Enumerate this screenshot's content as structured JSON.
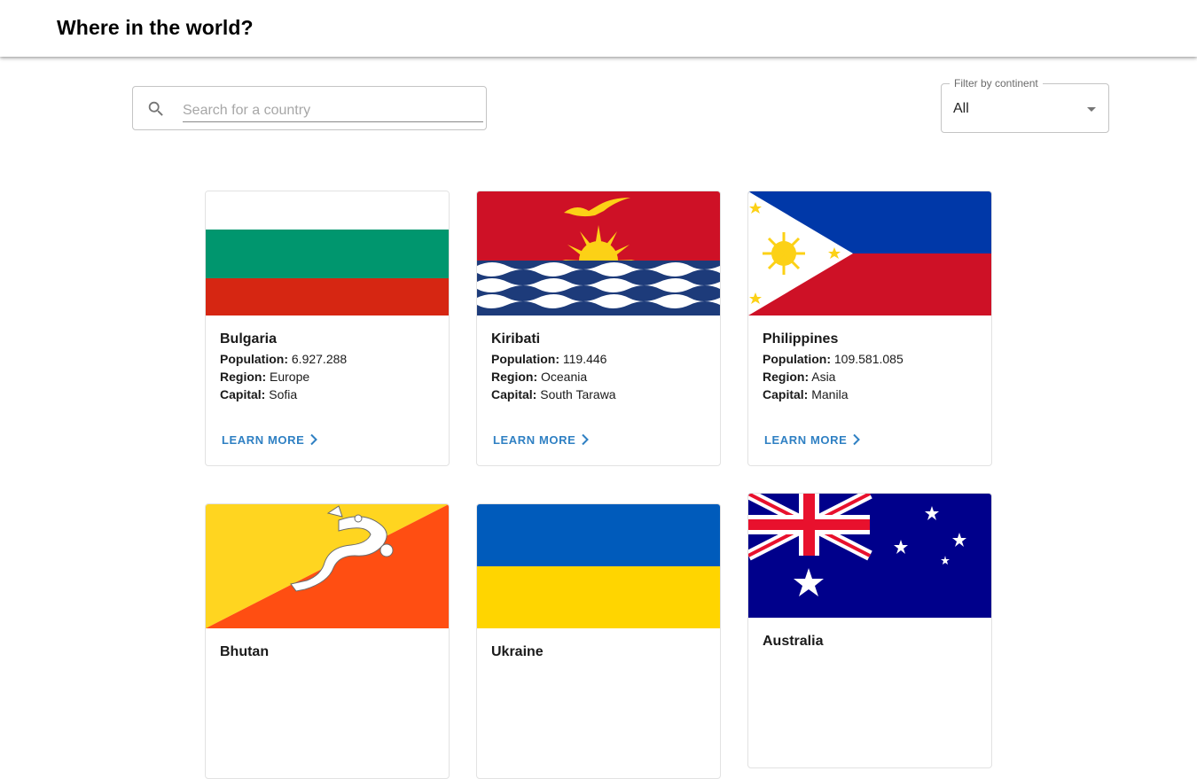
{
  "header": {
    "title": "Where in the world?"
  },
  "search": {
    "placeholder": "Search for a country",
    "value": ""
  },
  "filter": {
    "label": "Filter by continent",
    "value": "All"
  },
  "labels": {
    "population": "Population:",
    "region": "Region:",
    "capital": "Capital:",
    "learn_more": "LEARN MORE"
  },
  "countries": [
    {
      "name": "Bulgaria",
      "population": "6.927.288",
      "region": "Europe",
      "capital": "Sofia"
    },
    {
      "name": "Kiribati",
      "population": "119.446",
      "region": "Oceania",
      "capital": "South Tarawa"
    },
    {
      "name": "Philippines",
      "population": "109.581.085",
      "region": "Asia",
      "capital": "Manila"
    },
    {
      "name": "Bhutan"
    },
    {
      "name": "Ukraine"
    },
    {
      "name": "Australia"
    }
  ],
  "colors": {
    "accent": "#2f80c3",
    "border": "#c4c4c4"
  }
}
